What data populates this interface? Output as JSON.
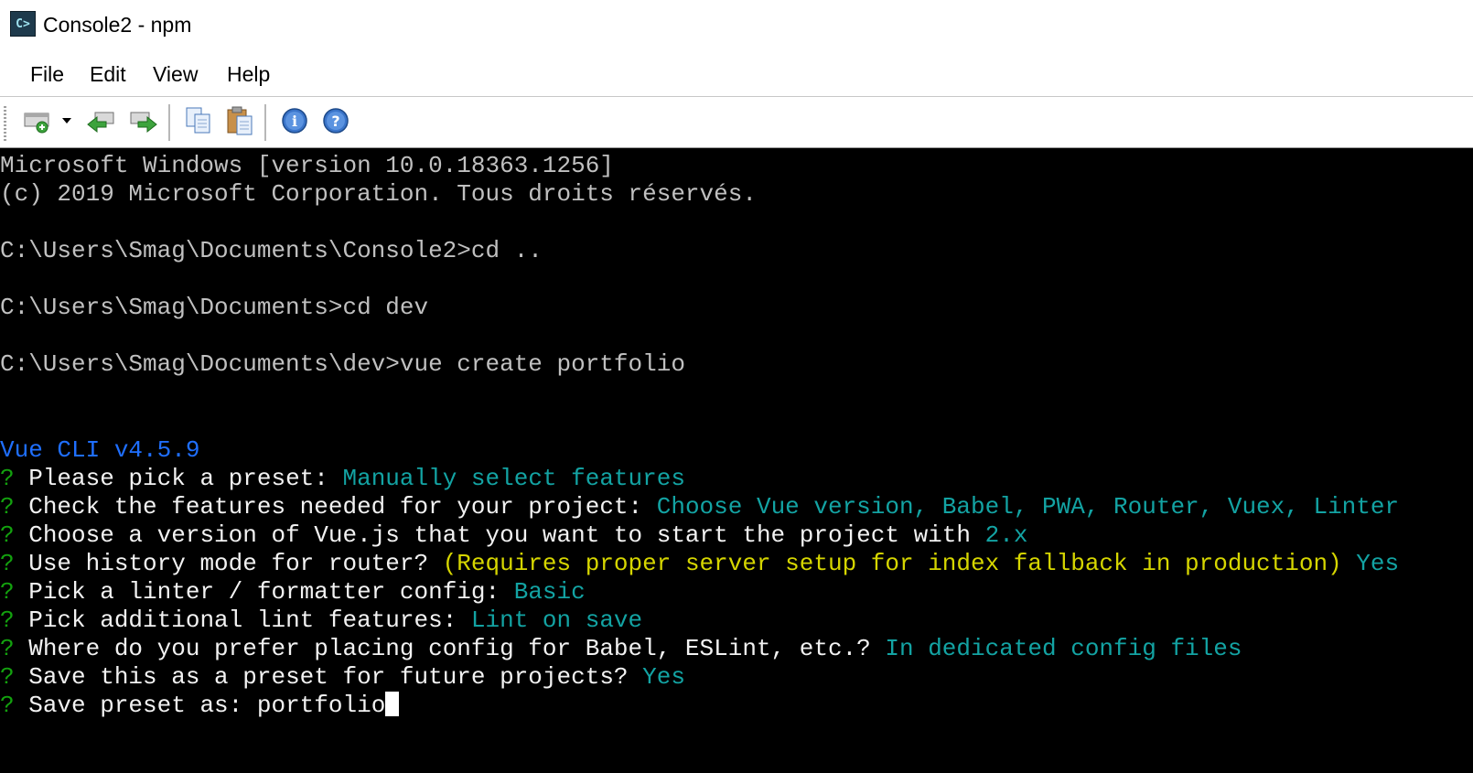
{
  "window": {
    "title": "Console2 - npm"
  },
  "menu": {
    "file": "File",
    "edit": "Edit",
    "view": "View",
    "help": "Help"
  },
  "toolbar": {
    "buttons": [
      "new-tab-icon",
      "dropdown-arrow-icon",
      "previous-tab-icon",
      "next-tab-icon",
      "copy-icon",
      "paste-icon",
      "info-icon",
      "help-icon"
    ]
  },
  "colors": {
    "terminal_bg": "#000000",
    "prompt_question": "#13a10e",
    "answer": "#13a3a3",
    "vue_cli": "#1f6fff",
    "hint": "#d6d600"
  },
  "terminal": {
    "l1": "Microsoft Windows [version 10.0.18363.1256]",
    "l2": "(c) 2019 Microsoft Corporation. Tous droits réservés.",
    "l3": "C:\\Users\\Smag\\Documents\\Console2>cd ..",
    "l4": "C:\\Users\\Smag\\Documents>cd dev",
    "l5": "C:\\Users\\Smag\\Documents\\dev>vue create portfolio",
    "vue_cli": "Vue CLI v4.5.9",
    "q_mark": "?",
    "q1": {
      "question": "Please pick a preset:",
      "answer": "Manually select features"
    },
    "q2": {
      "question": "Check the features needed for your project:",
      "answer": "Choose Vue version, Babel, PWA, Router, Vuex, Linter"
    },
    "q3": {
      "question": "Choose a version of Vue.js that you want to start the project with",
      "answer": "2.x"
    },
    "q4": {
      "question": "Use history mode for router?",
      "hint": "(Requires proper server setup for index fallback in production)",
      "answer": "Yes"
    },
    "q5": {
      "question": "Pick a linter / formatter config:",
      "answer": "Basic"
    },
    "q6": {
      "question": "Pick additional lint features:",
      "answer": "Lint on save"
    },
    "q7": {
      "question": "Where do you prefer placing config for Babel, ESLint, etc.?",
      "answer": "In dedicated config files"
    },
    "q8": {
      "question": "Save this as a preset for future projects?",
      "answer": "Yes"
    },
    "q9": {
      "question": "Save preset as:",
      "input": "portfolio"
    }
  }
}
